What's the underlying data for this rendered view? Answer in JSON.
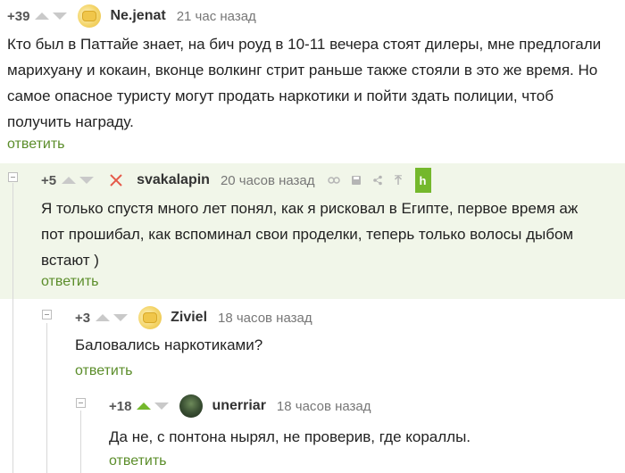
{
  "comments": [
    {
      "score": "+39",
      "nick": "Ne.jenat",
      "time": "21 час назад",
      "lines": [
        "Кто был в Паттайе знает, на бич роуд в 10-11 вечера стоят дилеры, мне предлогали",
        "марихуану и кокаин, вконце волкинг стрит раньше также стояли в это же время. Но",
        "самое опасное туристу могут продать наркотики и пойти здать полиции, чтоб",
        "получить награду."
      ],
      "reply": "ответить"
    },
    {
      "score": "+5",
      "nick": "svakalapin",
      "time": "20 часов назад",
      "badge": "h",
      "lines": [
        "Я только спустя много лет понял, как я рисковал в Египте, первое время аж",
        "пот прошибал, как вспоминал свои проделки, теперь только волосы дыбом",
        "встают )"
      ],
      "reply": "ответить"
    },
    {
      "score": "+3",
      "nick": "Ziviel",
      "time": "18 часов назад",
      "lines": [
        "Баловались наркотиками?"
      ],
      "reply": "ответить"
    },
    {
      "score": "+18",
      "nick": "unerriar",
      "time": "18 часов назад",
      "lines": [
        "Да не, с понтона нырял, не проверив, где кораллы."
      ],
      "reply": "ответить"
    }
  ],
  "colors": {
    "accent": "#74b82c",
    "reply": "#5b8d2a",
    "highlight": "#f1f6e9"
  }
}
